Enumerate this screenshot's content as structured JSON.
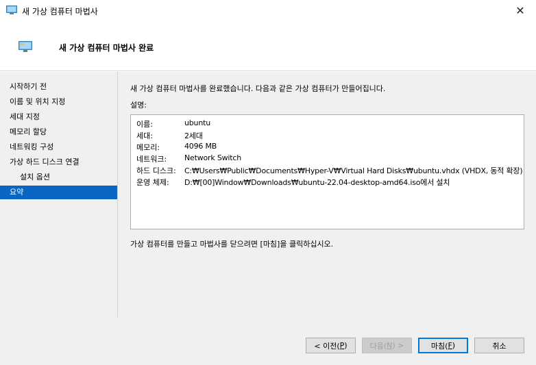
{
  "window": {
    "title": "새 가상 컴퓨터 마법사",
    "close_glyph": "✕"
  },
  "header": {
    "heading": "새 가상 컴퓨터 마법사 완료"
  },
  "sidebar": {
    "items": [
      {
        "label": "시작하기 전"
      },
      {
        "label": "이름 및 위치 지정"
      },
      {
        "label": "세대 지정"
      },
      {
        "label": "메모리 할당"
      },
      {
        "label": "네트워킹 구성"
      },
      {
        "label": "가상 하드 디스크 연결"
      },
      {
        "label": "설치 옵션"
      },
      {
        "label": "요약"
      }
    ]
  },
  "content": {
    "intro": "새 가상 컴퓨터 마법사를 완료했습니다. 다음과 같은 가상 컴퓨터가 만들어집니다.",
    "desc_label": "설명:",
    "summary": [
      {
        "key": "이름:",
        "value": "ubuntu"
      },
      {
        "key": "세대:",
        "value": "2세대"
      },
      {
        "key": "메모리:",
        "value": "4096 MB"
      },
      {
        "key": "네트워크:",
        "value": "Network Switch"
      },
      {
        "key": "하드 디스크:",
        "value": "C:₩Users₩Public₩Documents₩Hyper-V₩Virtual Hard Disks₩ubuntu.vhdx (VHDX, 동적 확장)"
      },
      {
        "key": "운영 체제:",
        "value": "D:₩[00]Window₩Downloads₩ubuntu-22.04-desktop-amd64.iso에서 설치"
      }
    ],
    "finish_note": "가상 컴퓨터를 만들고 마법사를 닫으려면 [마침]을 클릭하십시오."
  },
  "buttons": {
    "prev": {
      "text": "< 이전(",
      "key": "P",
      "end": ")"
    },
    "next": {
      "text": "다음(",
      "key": "N",
      "end": ") >"
    },
    "finish": {
      "text": "마침(",
      "key": "F",
      "end": ")"
    },
    "cancel": {
      "label": "취소"
    }
  },
  "colors": {
    "active": "#0a64c2",
    "primary_border": "#0078d7"
  }
}
